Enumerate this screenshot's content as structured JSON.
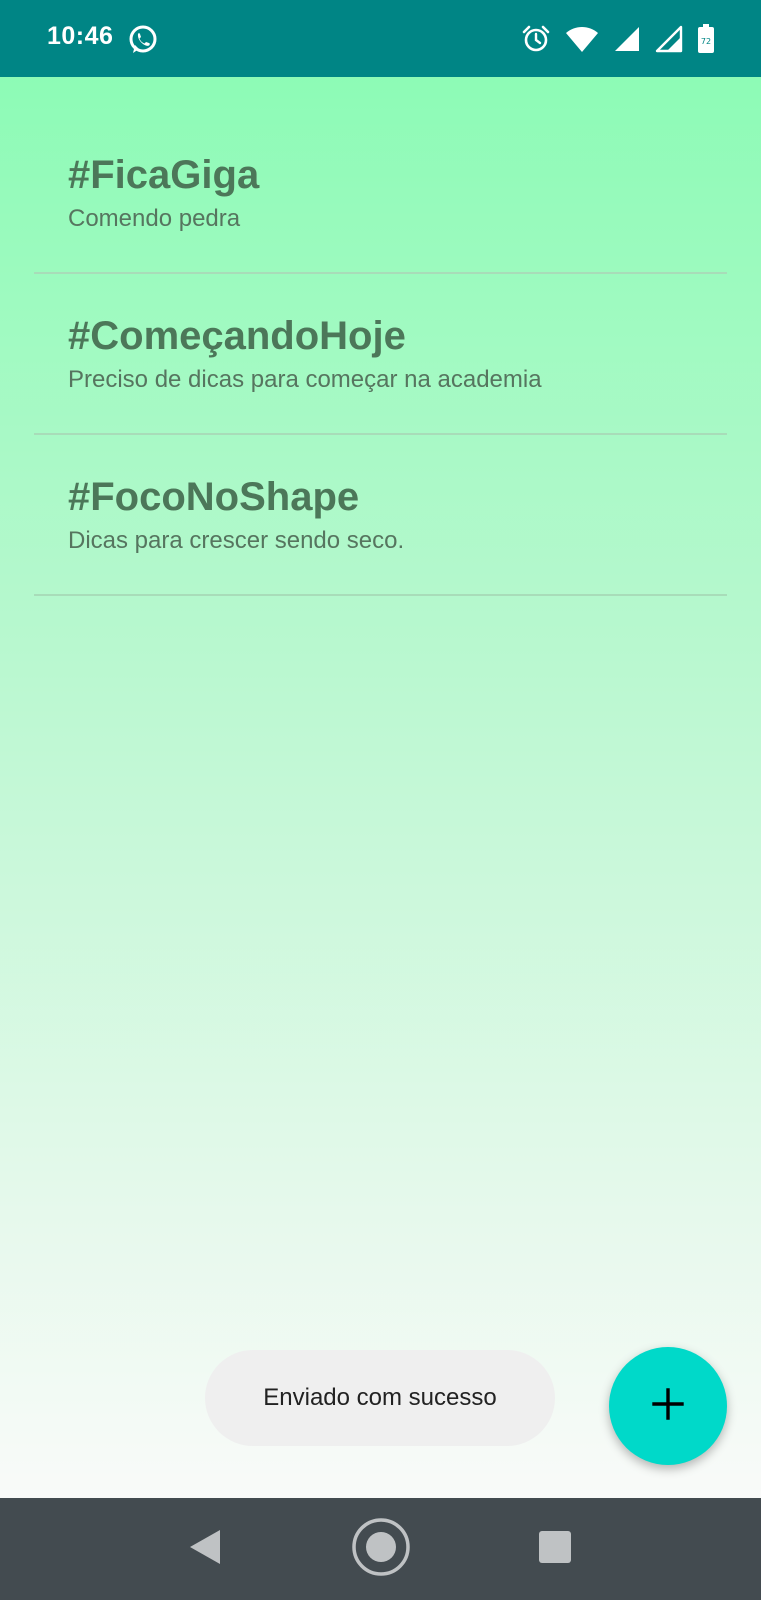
{
  "status_bar": {
    "time": "10:46",
    "battery_level": "72",
    "icons": [
      "whatsapp-icon",
      "alarm-icon",
      "wifi-icon",
      "signal-icon",
      "signal-icon-2",
      "battery-icon"
    ]
  },
  "posts": [
    {
      "title": "#FicaGiga",
      "subtitle": "Comendo pedra"
    },
    {
      "title": "#ComeçandoHoje",
      "subtitle": "Preciso de dicas para começar na academia"
    },
    {
      "title": "#FocoNoShape",
      "subtitle": "Dicas para crescer sendo seco."
    }
  ],
  "toast": {
    "message": "Enviado com sucesso"
  },
  "fab": {
    "icon": "plus-icon"
  },
  "nav_bar": {
    "icons": [
      "back-icon",
      "home-icon",
      "recents-icon"
    ]
  },
  "colors": {
    "status_bar": "#008585",
    "gradient_top": "#8dfbb6",
    "gradient_bottom": "#f9faf9",
    "title_text": "#4c7759",
    "subtitle_text": "#56755f",
    "divider": "#a8dcb9",
    "fab": "#00d9c9",
    "toast_bg": "#efefef",
    "nav_bar": "#434b50"
  }
}
